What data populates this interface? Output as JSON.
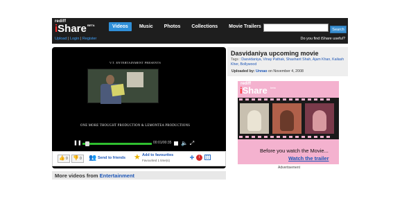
{
  "brand": {
    "top": "rediff",
    "name_i": "i",
    "name_rest": "Share",
    "badge": "BETA"
  },
  "nav": {
    "items": [
      {
        "label": "Videos",
        "active": true
      },
      {
        "label": "Music",
        "active": false
      },
      {
        "label": "Photos",
        "active": false
      },
      {
        "label": "Collections",
        "active": false
      },
      {
        "label": "Movie Trailers",
        "active": false
      }
    ]
  },
  "search": {
    "value": "",
    "button": "Search"
  },
  "account": {
    "upload": "Upload",
    "login": "Login",
    "register": "Register",
    "sep": "|"
  },
  "feedback": "Do you find iShare useful?",
  "player": {
    "presents": "V.T. ENTERTAINMENT PRESENTS",
    "credits": "ONE MORE THOUGHT PRODUCTION & LEMONTEA PRODUCTIONS",
    "time": "00:01/00:35",
    "progress": 0.04,
    "play_icon": "pause-icon"
  },
  "actions": {
    "votes_up": "0",
    "votes_down": "0",
    "send_friends": "Send to friends",
    "add_favourites": "Add to favourites",
    "favourited": "Favourited 1 time(s)"
  },
  "more_videos": {
    "prefix": "More videos from",
    "category": "Entertainment"
  },
  "video": {
    "title": "Dasvidaniya upcoming movie",
    "tags_label": "Tags :",
    "tags": "Dasvidaniya, Vinay Pathak, Shashant Shah, Ajam Khan, Kailash Kher, Bollywood",
    "uploaded_by_label": "Uploaded by:",
    "uploader": "Unnao",
    "upload_date": "on November 4, 2008"
  },
  "ad": {
    "logo_top": "rediff",
    "logo_i": "i",
    "logo_rest": "Share",
    "logo_badge": "beta",
    "line1": "Before you watch the Movie...",
    "line2": "Watch the trailer",
    "label": "Advertisement"
  },
  "colors": {
    "accent": "#2f8fd8",
    "link": "#1c55b6",
    "header": "#1e1e1e",
    "ad_bg": "#f4b2cf"
  }
}
